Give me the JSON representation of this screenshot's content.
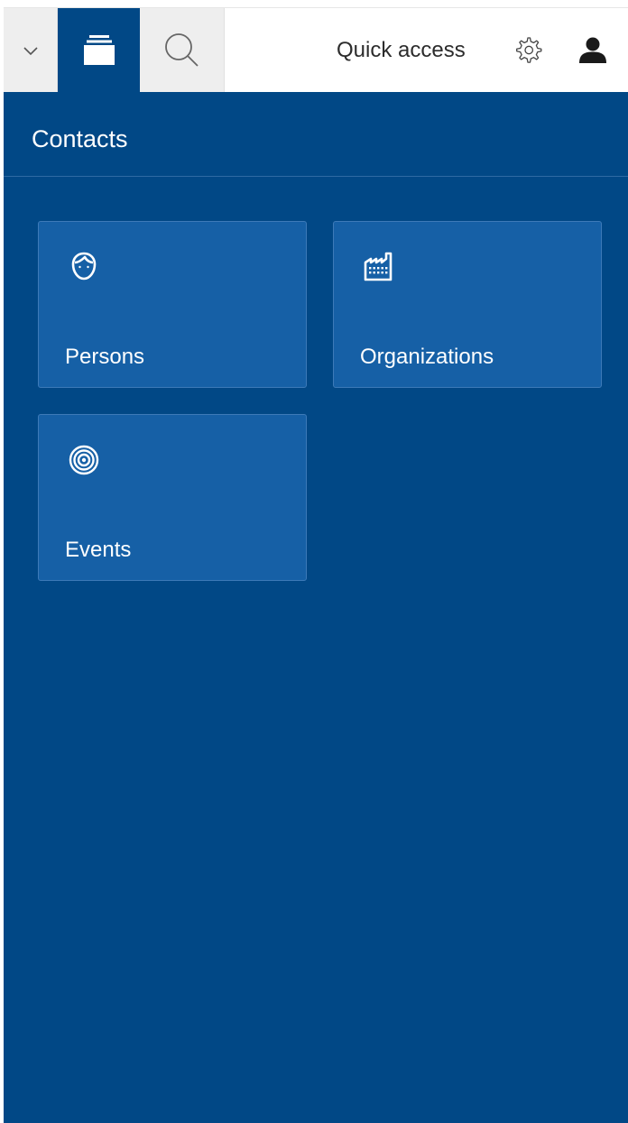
{
  "toolbar": {
    "quick_access_label": "Quick access",
    "icons": {
      "collapse": "chevron-down-icon",
      "outline": "stack-icon",
      "search": "search-icon",
      "settings": "gear-icon",
      "user": "user-icon"
    }
  },
  "panel": {
    "title": "Contacts",
    "tiles": [
      {
        "label": "Persons",
        "icon": "person-head-icon"
      },
      {
        "label": "Organizations",
        "icon": "factory-icon"
      },
      {
        "label": "Events",
        "icon": "target-icon"
      }
    ]
  },
  "colors": {
    "primary": "#014886",
    "tile": "#1660a6",
    "toolbar_bg": "#eeeeee"
  }
}
